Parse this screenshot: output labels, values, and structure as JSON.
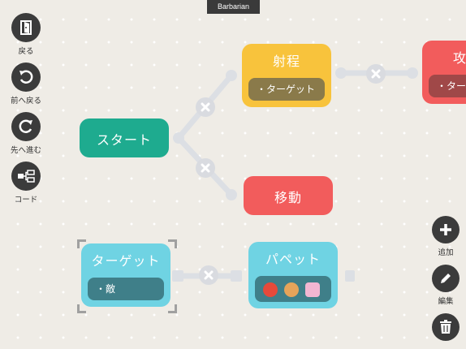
{
  "topbar": {
    "title": "Barbarian"
  },
  "left_tools": [
    {
      "label": "戻る",
      "icon": "exit-door-icon"
    },
    {
      "label": "前へ戻る",
      "icon": "undo-icon"
    },
    {
      "label": "先へ進む",
      "icon": "redo-icon"
    },
    {
      "label": "コード",
      "icon": "code-tree-icon"
    }
  ],
  "right_tools": [
    {
      "label": "追加",
      "icon": "plus-icon"
    },
    {
      "label": "編集",
      "icon": "pencil-icon"
    },
    {
      "label": "",
      "icon": "trash-icon"
    }
  ],
  "nodes": {
    "start": {
      "title": "スタート",
      "color": "#1eab8f"
    },
    "range": {
      "title": "射程",
      "param": "・ターゲット",
      "color": "#f8c33c"
    },
    "attack": {
      "title": "攻",
      "param": "・ターゲ",
      "color": "#f25c5c"
    },
    "move": {
      "title": "移動",
      "color": "#f25c5c"
    },
    "target": {
      "title": "ターゲット",
      "param": "・敵",
      "color": "#6fd3e3"
    },
    "puppet": {
      "title": "パペット",
      "color": "#6fd3e3",
      "icons": [
        "red-bird-icon",
        "orange-creature-icon",
        "pink-robot-icon"
      ]
    }
  }
}
